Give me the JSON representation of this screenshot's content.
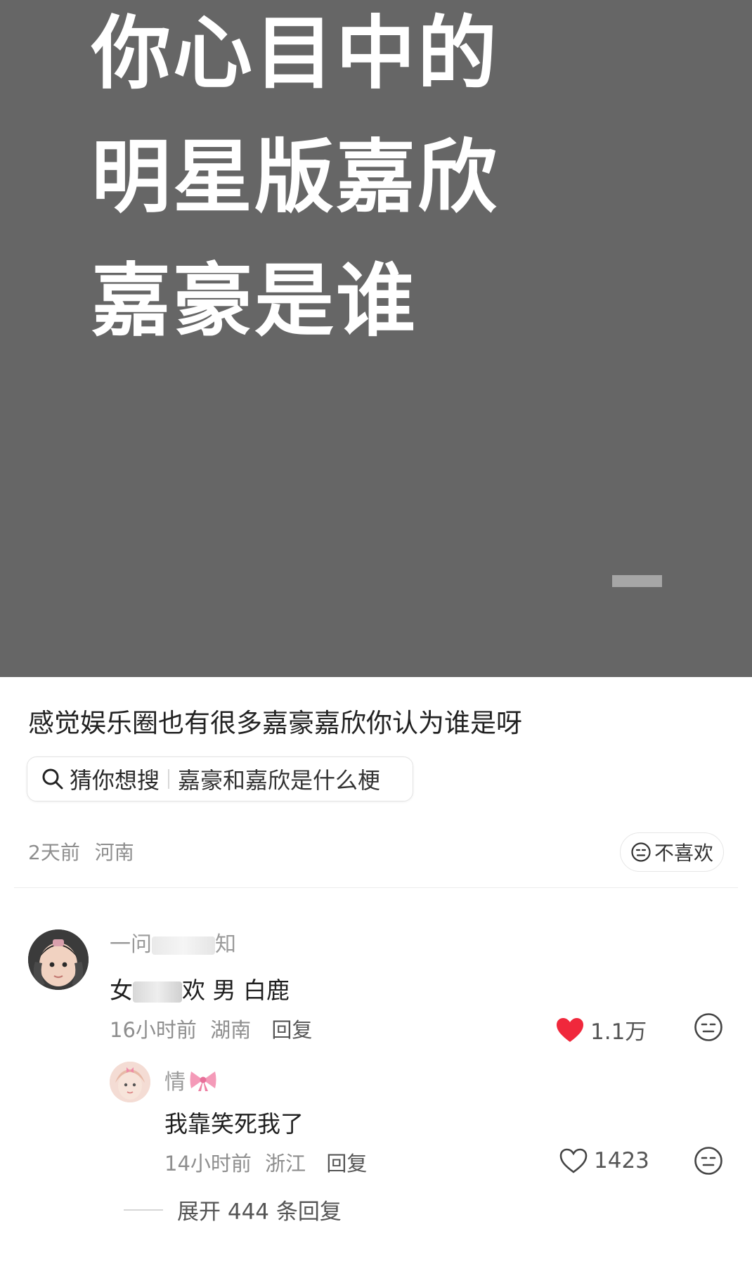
{
  "hero": {
    "line1": "你心目中的",
    "line2": "明星版嘉欣",
    "line3": "嘉豪是谁"
  },
  "post": {
    "text": "感觉娱乐圈也有很多嘉豪嘉欣你认为谁是呀",
    "search_prefix": "猜你想搜",
    "search_query": "嘉豪和嘉欣是什么梗",
    "time": "2天前",
    "location": "河南",
    "dislike_label": "不喜欢"
  },
  "comments": [
    {
      "username_start": "一问",
      "username_end": "知",
      "body_start": "女",
      "body_mid": "欢",
      "body_end": "男 白鹿",
      "time": "16小时前",
      "location": "湖南",
      "reply_label": "回复",
      "likes": "1.1万",
      "liked": true,
      "reply": {
        "username": "情",
        "body": "我靠笑死我了",
        "time": "14小时前",
        "location": "浙江",
        "reply_label": "回复",
        "likes": "1423",
        "liked": false
      }
    }
  ],
  "expand_label": "展开 444 条回复",
  "colors": {
    "hero_bg": "#666666",
    "like_red": "#f0283c",
    "meta_gray": "#8e8e8e"
  },
  "icons": [
    "search-icon",
    "neutral-face-icon",
    "heart-icon",
    "bow-emoji-icon"
  ]
}
